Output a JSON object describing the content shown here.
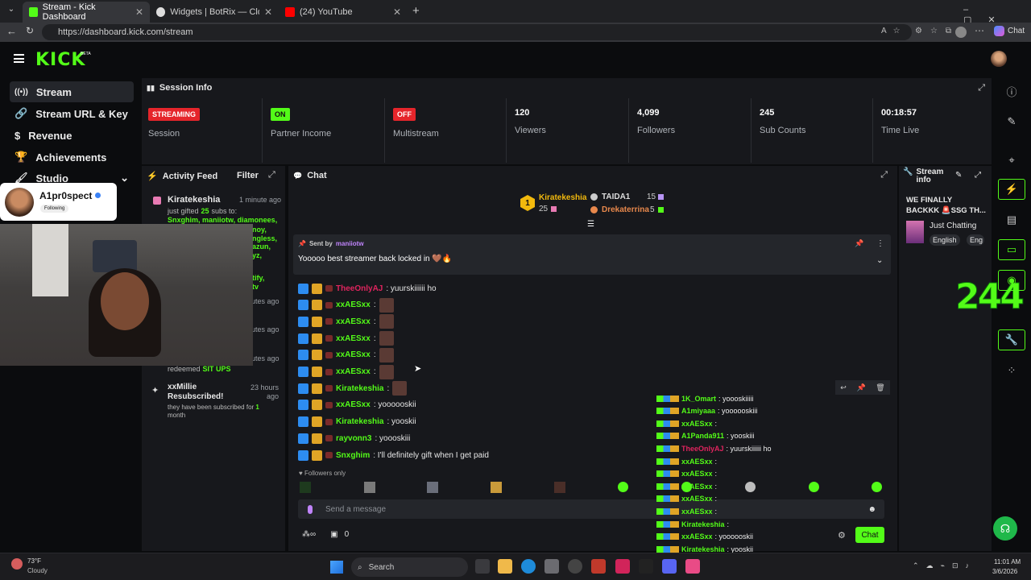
{
  "browser": {
    "tabs": [
      {
        "label": "Stream - Kick Dashboard",
        "active": true
      },
      {
        "label": "Widgets | BotRix — Cloud Streami",
        "active": false
      },
      {
        "label": "(24) YouTube",
        "active": false
      }
    ],
    "url": "https://dashboard.kick.com/stream",
    "chat_button": "Chat"
  },
  "app": {
    "logo": "KICK",
    "logo_tag": "BETA"
  },
  "sidebar": {
    "items": [
      {
        "label": "Stream",
        "icon": "broadcast-icon"
      },
      {
        "label": "Stream URL & Key",
        "icon": "link-icon"
      },
      {
        "label": "Revenue",
        "icon": "dollar-icon"
      },
      {
        "label": "Achievements",
        "icon": "trophy-icon"
      },
      {
        "label": "Studio",
        "icon": "brush-icon"
      }
    ]
  },
  "session": {
    "title": "Session Info",
    "stats": [
      {
        "badge": "STREAMING",
        "label": "Session",
        "color": "#e5252b"
      },
      {
        "badge": "ON",
        "label": "Partner Income",
        "color": "#53fc18"
      },
      {
        "badge": "OFF",
        "label": "Multistream",
        "color": "#e5252b"
      },
      {
        "value": "120",
        "label": "Viewers"
      },
      {
        "value": "4,099",
        "label": "Followers"
      },
      {
        "value": "245",
        "label": "Sub Counts"
      },
      {
        "value": "00:18:57",
        "label": "Time Live"
      }
    ]
  },
  "activity": {
    "title": "Activity Feed",
    "filter": "Filter",
    "items": [
      {
        "user": "Kiratekeshia",
        "time": "1 minute ago",
        "text": "just gifted",
        "count": "25",
        "text2": "subs to:",
        "names": "Snxghim, maniiotw, diamonees,",
        "names_tail": [
          "noy,",
          "ngless,",
          "azun,",
          "yz,",
          "tify,",
          "tv"
        ]
      },
      {
        "time_a": "utes ago",
        "time_b": "utes ago",
        "time_c": "utes ago"
      },
      {
        "redeemed": "redeemed",
        "reward": "SIT UPS"
      },
      {
        "user": "xxMillie",
        "title": "Resubscribed!",
        "time": "23 hours ago",
        "text": "they have been subscribed for",
        "months": "1",
        "unit": "month"
      }
    ]
  },
  "webcam": {
    "name": "A1pr0spect",
    "following": "Following"
  },
  "chat": {
    "title": "Chat",
    "leaders": [
      {
        "rank": "1",
        "name": "Kiratekeshia",
        "count": "25"
      },
      {
        "name": "TAIDA1",
        "count": "15"
      },
      {
        "name": "Drekaterrina",
        "count": "5"
      }
    ],
    "pinned": {
      "sent_by": "Sent by",
      "author": "maniiotw",
      "text": "Yooooo best streamer back locked in 🤎🔥"
    },
    "messages": [
      {
        "user": "TheeOnlyAJ",
        "color": "#e0245e",
        "text": ": yuurskiiiiii ho",
        "emote": false
      },
      {
        "user": "xxAESxx",
        "color": "#53fc18",
        "text": ":",
        "emote": true
      },
      {
        "user": "xxAESxx",
        "color": "#53fc18",
        "text": ":",
        "emote": true
      },
      {
        "user": "xxAESxx",
        "color": "#53fc18",
        "text": ":",
        "emote": true
      },
      {
        "user": "xxAESxx",
        "color": "#53fc18",
        "text": ":",
        "emote": true
      },
      {
        "user": "xxAESxx",
        "color": "#53fc18",
        "text": ":",
        "emote": true
      },
      {
        "user": "Kiratekeshia",
        "color": "#53fc18",
        "text": ":",
        "emote": true
      },
      {
        "user": "xxAESxx",
        "color": "#53fc18",
        "text": ": yoooooskii",
        "emote": false
      },
      {
        "user": "Kiratekeshia",
        "color": "#53fc18",
        "text": ": yooskii",
        "emote": false
      },
      {
        "user": "rayvonn3",
        "color": "#53fc18",
        "text": ": yoooskiii",
        "emote": false
      },
      {
        "user": "Snxghim",
        "color": "#53fc18",
        "text": ": I'll definitely gift when I get paid",
        "emote": false
      }
    ],
    "followers_only": "Followers only",
    "input_placeholder": "Send a message",
    "points": "0",
    "send_label": "Chat"
  },
  "overlay_chat": [
    {
      "user": "1K_Omart",
      "color": "#53fc18",
      "text": ": yoooskiiiii"
    },
    {
      "user": "A1miyaaa",
      "color": "#53fc18",
      "text": ": yoooooskiii"
    },
    {
      "user": "xxAESxx",
      "color": "#53fc18",
      "text": ":"
    },
    {
      "user": "A1Panda911",
      "color": "#53fc18",
      "text": ": yooskiii"
    },
    {
      "user": "TheeOnlyAJ",
      "color": "#e0245e",
      "text": ": yuurskiiiiii ho"
    },
    {
      "user": "xxAESxx",
      "color": "#53fc18",
      "text": ":"
    },
    {
      "user": "xxAESxx",
      "color": "#53fc18",
      "text": ":"
    },
    {
      "user": "xxAESxx",
      "color": "#53fc18",
      "text": ":"
    },
    {
      "user": "xxAESxx",
      "color": "#53fc18",
      "text": ":"
    },
    {
      "user": "xxAESxx",
      "color": "#53fc18",
      "text": ":"
    },
    {
      "user": "Kiratekeshia",
      "color": "#53fc18",
      "text": ":"
    },
    {
      "user": "xxAESxx",
      "color": "#53fc18",
      "text": ": yoooooskii"
    },
    {
      "user": "Kiratekeshia",
      "color": "#53fc18",
      "text": ": yooskii"
    },
    {
      "user": "rayvonn3",
      "color": "#53fc18",
      "text": ": yooskiii"
    },
    {
      "user": "Snxghim",
      "color": "#53fc18",
      "text": ": I'll definitely gift when I get paid"
    }
  ],
  "stream_info": {
    "title": "Stream info",
    "headline": "WE FINALLY BACKKK 🚨SSG TH...",
    "category": "Just Chatting",
    "tags": [
      "English",
      "Eng"
    ]
  },
  "overlay_counter": "244",
  "taskbar": {
    "weather_temp": "73°F",
    "weather_text": "Cloudy",
    "search": "Search",
    "time": "11:01 AM",
    "date": "3/6/2026"
  },
  "colors": {
    "kick_green": "#53fc18",
    "red": "#e5252b",
    "panel": "#17181c"
  }
}
